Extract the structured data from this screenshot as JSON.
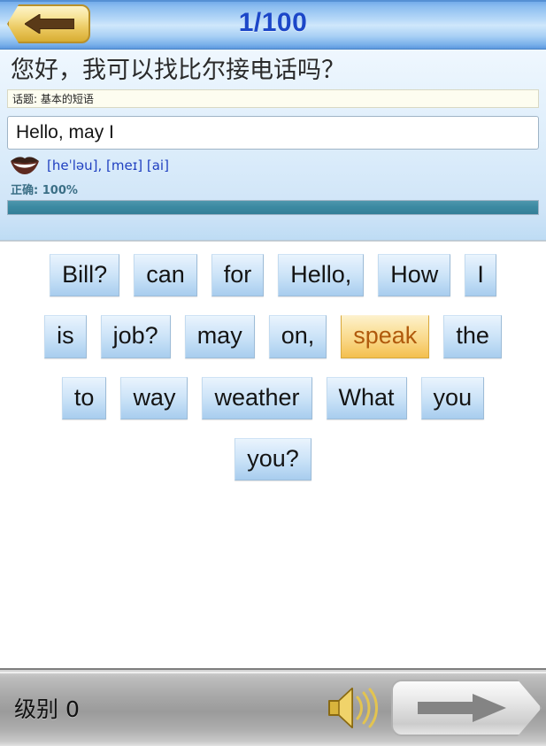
{
  "header": {
    "back_icon": "arrow-left-icon",
    "title": "1/100",
    "title_color": "#1c47c8"
  },
  "prompt": {
    "sentence_cn": "您好，我可以找比尔接电话吗？",
    "topic_line": "话题: 基本的短语",
    "answer_value": "Hello, may I",
    "answer_placeholder": "",
    "speak_icon": "lips-icon",
    "phonetic": "[heˈləu], [meɪ] [ai]",
    "phonetic_color": "#1f3fc0",
    "score_label": "正确: 100%",
    "score_percent": 100,
    "progress_color": "#3c8aa2"
  },
  "wordbank": {
    "rows": [
      [
        {
          "label": "Bill?",
          "selected": false
        },
        {
          "label": "can",
          "selected": false
        },
        {
          "label": "for",
          "selected": false
        },
        {
          "label": "Hello,",
          "selected": false
        },
        {
          "label": "How",
          "selected": false
        },
        {
          "label": "I",
          "selected": false
        }
      ],
      [
        {
          "label": "is",
          "selected": false
        },
        {
          "label": "job?",
          "selected": false
        },
        {
          "label": "may",
          "selected": false
        },
        {
          "label": "on,",
          "selected": false
        },
        {
          "label": "speak",
          "selected": true
        },
        {
          "label": "the",
          "selected": false
        }
      ],
      [
        {
          "label": "to",
          "selected": false
        },
        {
          "label": "way",
          "selected": false
        },
        {
          "label": "weather",
          "selected": false
        },
        {
          "label": "What",
          "selected": false
        },
        {
          "label": "you",
          "selected": false
        }
      ],
      [
        {
          "label": "you?",
          "selected": false
        }
      ]
    ],
    "selected_color": "#b05a0c",
    "selected_bg": "#f9d787"
  },
  "footer": {
    "level_label": "级别 0",
    "speaker_icon": "speaker-icon",
    "next_icon": "arrow-right-icon"
  }
}
